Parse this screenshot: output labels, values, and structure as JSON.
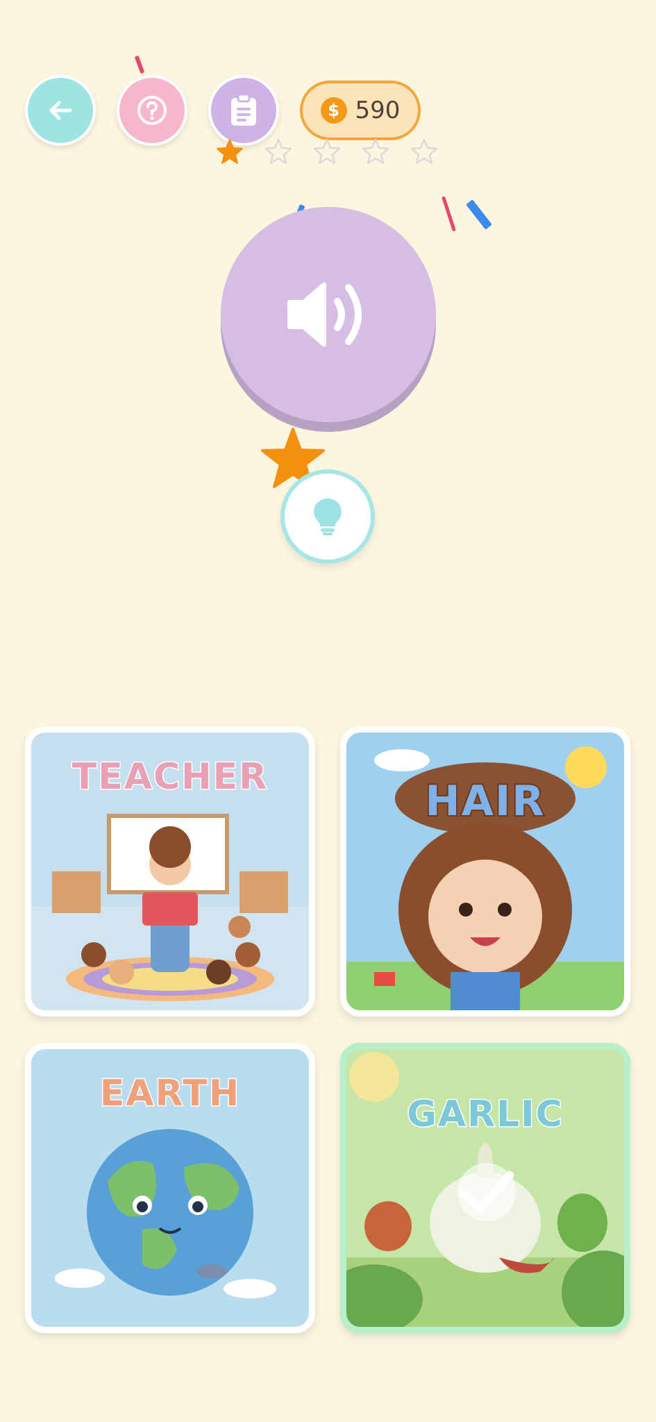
{
  "toolbar": {
    "back_icon": "arrow-left-icon",
    "help_icon": "question-circle-icon",
    "notes_icon": "clipboard-icon"
  },
  "coins": {
    "icon": "dollar-coin-icon",
    "symbol": "$",
    "count": "590"
  },
  "progress_stars": {
    "earned": 1,
    "total": 5,
    "filled_color": "#f5900f",
    "empty_color": "#d9d9d9"
  },
  "speaker": {
    "icon": "speaker-volume-icon"
  },
  "hint": {
    "icon": "lightbulb-icon"
  },
  "cards": [
    {
      "word": "TEACHER"
    },
    {
      "word": "HAIR"
    },
    {
      "word": "EARTH"
    },
    {
      "word": "GARLIC",
      "selected": true,
      "status_icon": "checkmark-icon"
    }
  ],
  "colors": {
    "background": "#fcf5e0",
    "back_button": "#9ee4e3",
    "help_button": "#f7b6cc",
    "notes_button": "#cfb2e6",
    "speaker_button": "#d6bde4",
    "coin_border": "#f5a63a",
    "correct_border": "#b6efc8"
  }
}
